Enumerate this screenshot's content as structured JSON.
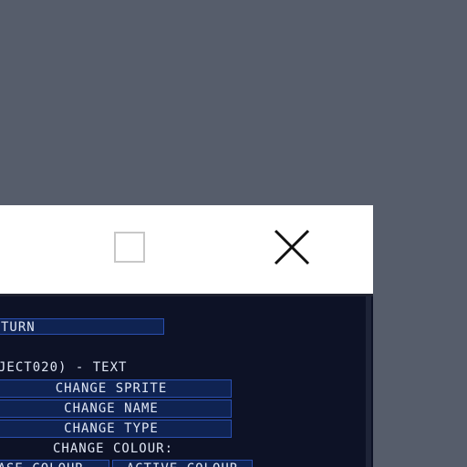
{
  "window": {
    "maximize_icon": "maximize-square-icon",
    "close_icon": "close-x-icon"
  },
  "panel": {
    "return_label": "TURN",
    "object_heading": "JECT020) - TEXT",
    "change_sprite": "CHANGE SPRITE",
    "change_name": "CHANGE NAME",
    "change_type": "CHANGE TYPE",
    "change_colour_heading": "CHANGE COLOUR:",
    "base_colour": "BASE COLOUR",
    "active_colour": "ACTIVE COLOUR"
  },
  "colors": {
    "desktop": "#565d6b",
    "titlebar": "#ffffff",
    "panel_bg": "#0d1226",
    "button_bg": "#0f2352",
    "button_border": "#2a4fb0",
    "text": "#dfe6f4"
  }
}
